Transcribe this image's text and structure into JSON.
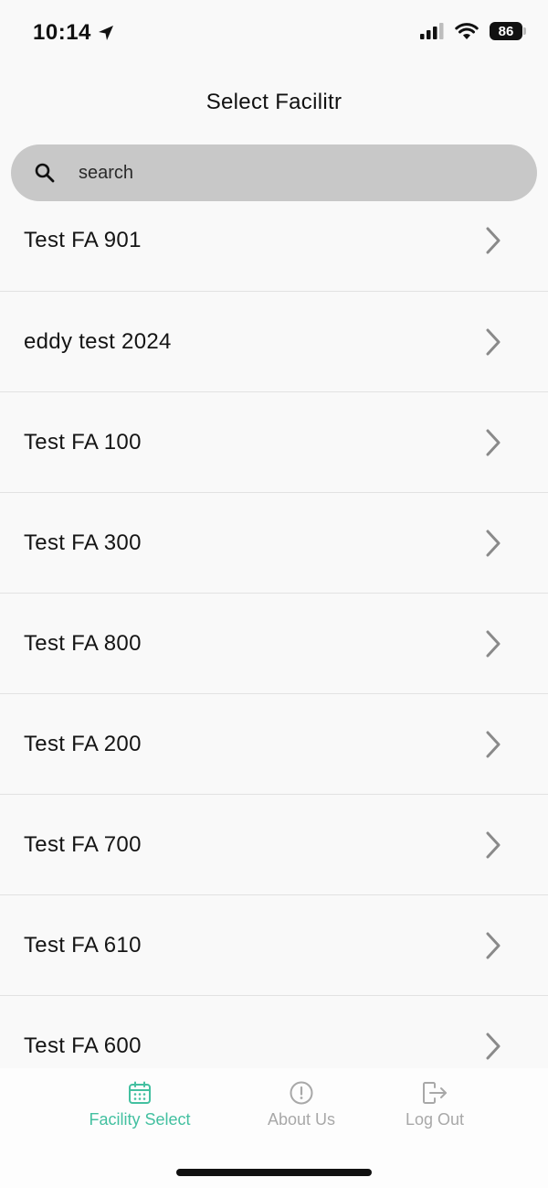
{
  "status_bar": {
    "time": "10:14",
    "battery": "86"
  },
  "header": {
    "title": "Select Facilitr"
  },
  "search": {
    "placeholder": "search",
    "value": ""
  },
  "list": {
    "items": [
      {
        "label": "Test FA 901"
      },
      {
        "label": "eddy test 2024"
      },
      {
        "label": "Test FA 100"
      },
      {
        "label": "Test FA 300"
      },
      {
        "label": "Test FA 800"
      },
      {
        "label": "Test FA 200"
      },
      {
        "label": "Test FA 700"
      },
      {
        "label": "Test FA 610"
      },
      {
        "label": "Test FA 600"
      }
    ]
  },
  "tab_bar": {
    "facility_select": "Facility Select",
    "about_us": "About Us",
    "log_out": "Log Out",
    "active": "facility_select"
  },
  "colors": {
    "accent": "#43c0a0",
    "inactive": "#a8a8a8",
    "search_bg": "#c8c8c8"
  }
}
